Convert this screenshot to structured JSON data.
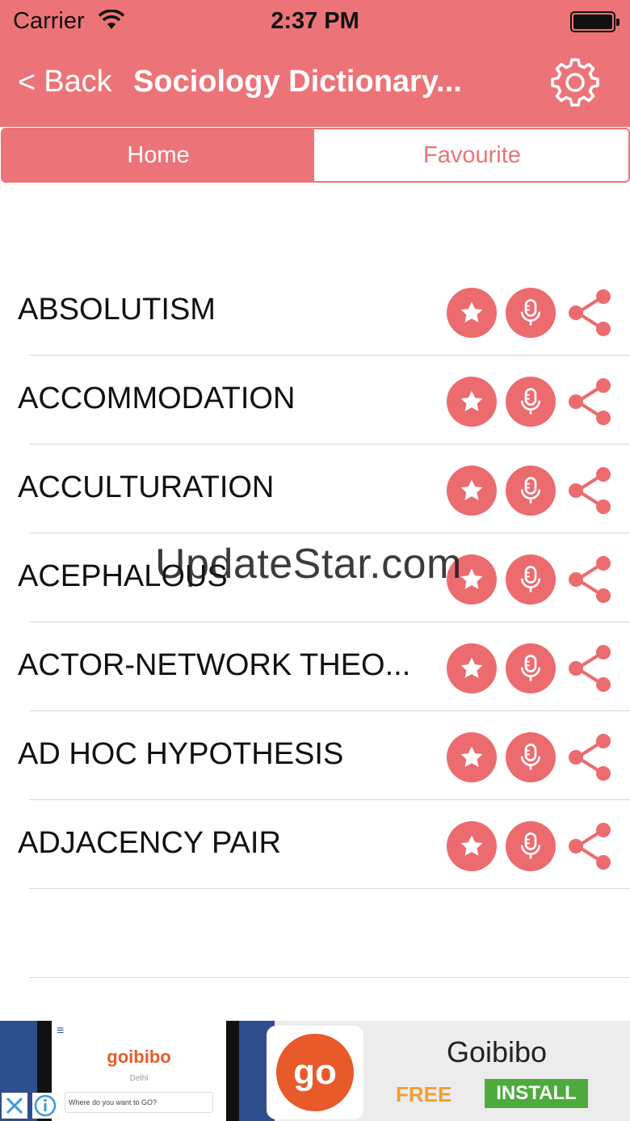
{
  "status_bar": {
    "carrier": "Carrier",
    "time": "2:37 PM"
  },
  "navbar": {
    "back_label": "Back",
    "title": "Sociology Dictionary..."
  },
  "tabs": [
    {
      "label": "Home",
      "selected": true
    },
    {
      "label": "Favourite",
      "selected": false
    }
  ],
  "terms": [
    "ABSOLUTISM",
    "ACCOMMODATION",
    "ACCULTURATION",
    "ACEPHALOUS",
    "ACTOR-NETWORK THEO...",
    "AD HOC HYPOTHESIS",
    "ADJACENCY PAIR"
  ],
  "watermark": "UpdateStar.com",
  "ad": {
    "logo_text": "go",
    "screenshot_brand": "goibibo",
    "screenshot_city": "Delhi",
    "screenshot_search_placeholder": "Where do you want to GO?",
    "title": "Goibibo",
    "price": "FREE",
    "cta": "INSTALL"
  },
  "colors": {
    "accent": "#ec7478",
    "icon_button": "#ec6b6f",
    "install_green": "#4cab3c",
    "free_orange": "#f0a030"
  },
  "icons": {
    "favourite": "star-icon",
    "pronounce": "microphone-icon",
    "share": "share-icon",
    "settings": "gear-icon"
  }
}
